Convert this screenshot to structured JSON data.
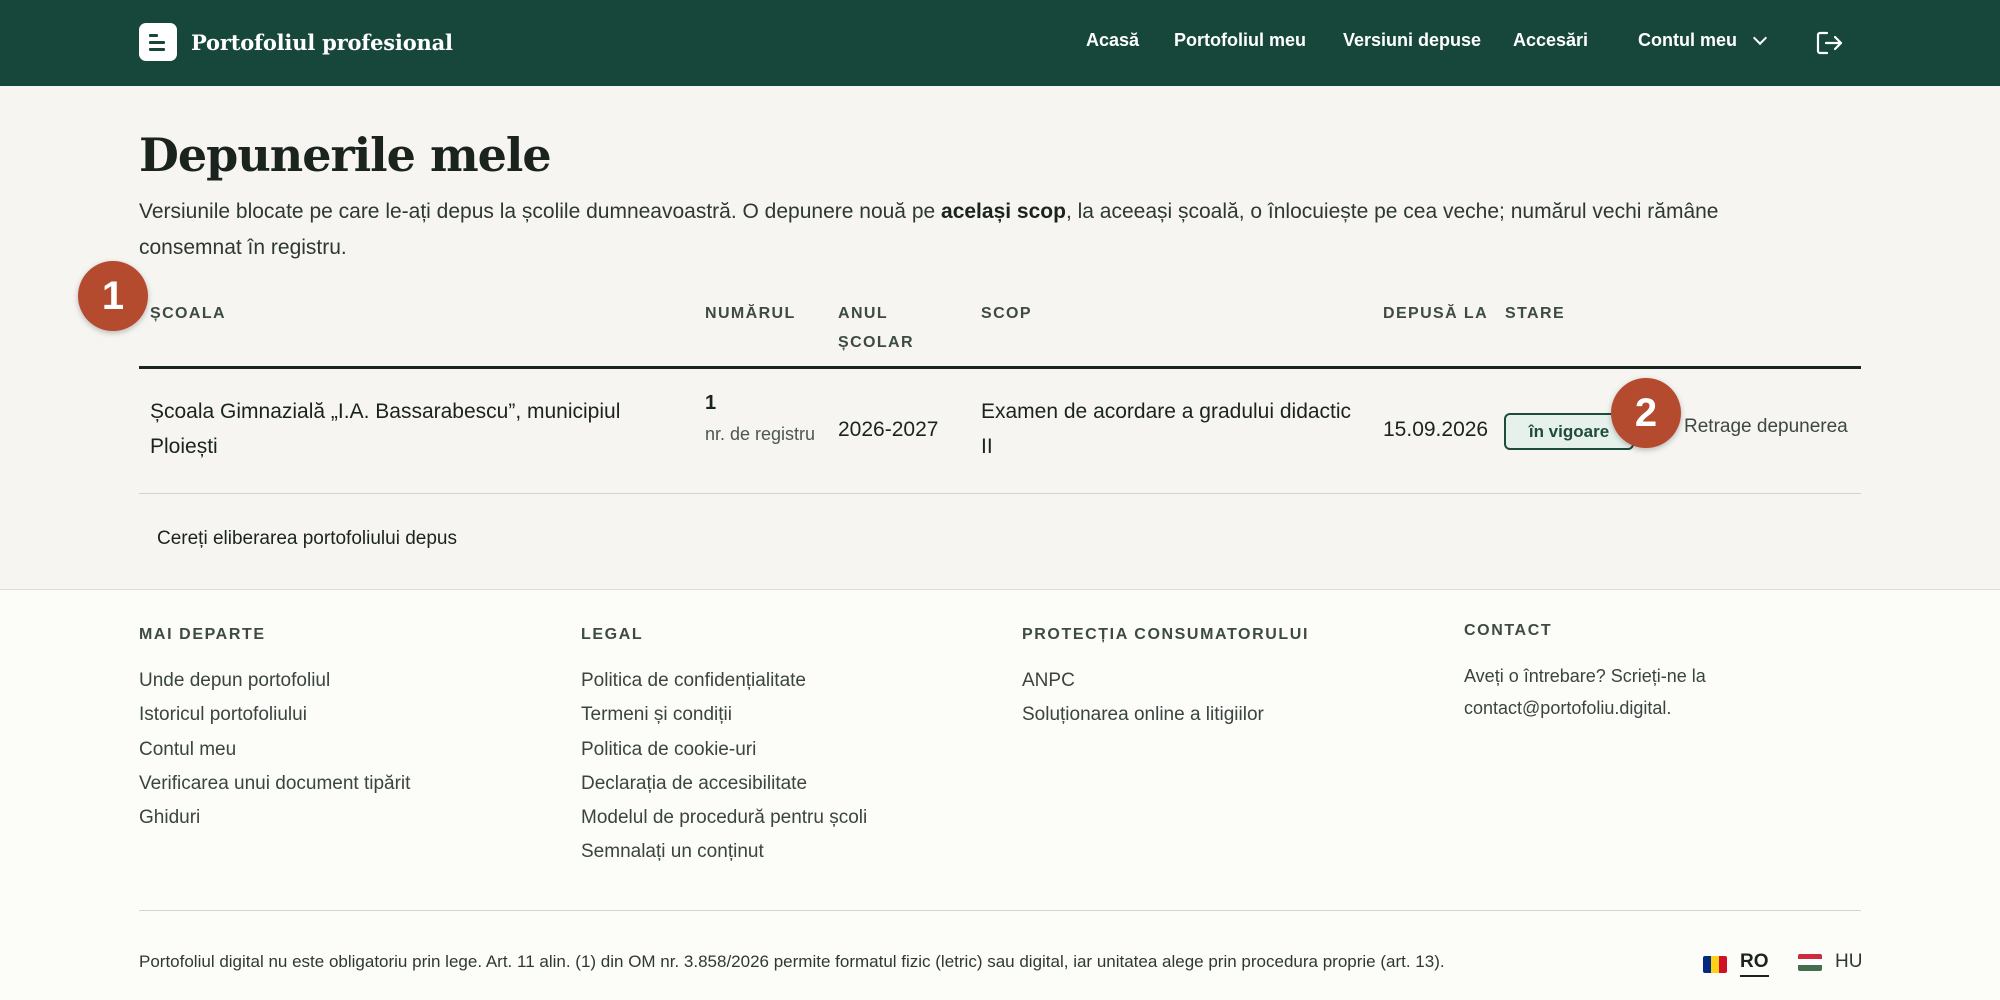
{
  "header": {
    "brand": "Portofoliul profesional",
    "nav": {
      "home": "Acasă",
      "my_portfolio": "Portofoliul meu",
      "submitted_versions": "Versiuni depuse",
      "accesses": "Accesări",
      "account": "Contul meu"
    },
    "icons": {
      "brand": "document-logo-icon",
      "account_menu": "chevron-down-icon",
      "logout": "logout-icon"
    }
  },
  "main": {
    "title": "Depunerile mele",
    "intro_before": "Versiunile blocate pe care le-ați depus la școlile dumneavoastră. O depunere nouă pe ",
    "intro_bold": "același scop",
    "intro_after": ", la aceeași școală, o înlocuiește pe cea veche; numărul vechi rămâne consemnat în registru.",
    "table": {
      "headers": [
        "ȘCOALA",
        "NUMĂRUL",
        "ANUL ȘCOLAR",
        "SCOP",
        "DEPUSĂ LA",
        "STARE"
      ],
      "rows": [
        {
          "school": "Școala Gimnazială „I.A. Bassarabescu”, municipiul Ploiești",
          "number": "1",
          "number_caption": "nr. de registru",
          "school_year": "2026-2027",
          "purpose": "Examen de acordare a gradului didactic II",
          "submitted_at": "15.09.2026",
          "status": "în vigoare",
          "action": "Retrage depunerea"
        }
      ]
    },
    "release_button": "Cereți eliberarea portofoliului depus",
    "markers": [
      "1",
      "2"
    ]
  },
  "footer": {
    "columns": [
      {
        "heading": "MAI DEPARTE",
        "links": [
          "Unde depun portofoliul",
          "Istoricul portofoliului",
          "Contul meu",
          "Verificarea unui document tipărit",
          "Ghiduri"
        ]
      },
      {
        "heading": "LEGAL",
        "links": [
          "Politica de confidențialitate",
          "Termeni și condiții",
          "Politica de cookie-uri",
          "Declarația de accesibilitate",
          "Modelul de procedură pentru școli",
          "Semnalați un conținut"
        ]
      },
      {
        "heading": "PROTECȚIA CONSUMATORULUI",
        "links": [
          "ANPC",
          "Soluționarea online a litigiilor"
        ]
      }
    ],
    "contact": {
      "heading": "CONTACT",
      "text": "Aveți o întrebare? Scrieți-ne la contact@portofoliu.digital."
    },
    "legal_note": "Portofoliul digital nu este obligatoriu prin lege. Art. 11 alin. (1) din OM nr. 3.858/2026 permite formatul fizic (letric) sau digital, iar unitatea alege prin procedura proprie (art. 13).",
    "languages": [
      {
        "code": "RO",
        "active": true,
        "flag_colors": [
          "#002b7f",
          "#fcd116",
          "#ce1126"
        ]
      },
      {
        "code": "HU",
        "active": false,
        "flag_colors": [
          "#cd2a3e",
          "#ffffff",
          "#436f4d"
        ]
      }
    ]
  },
  "colors": {
    "header_bg": "#17473a",
    "accent": "#b44a2e",
    "page_bg": "#f6f5f1"
  }
}
